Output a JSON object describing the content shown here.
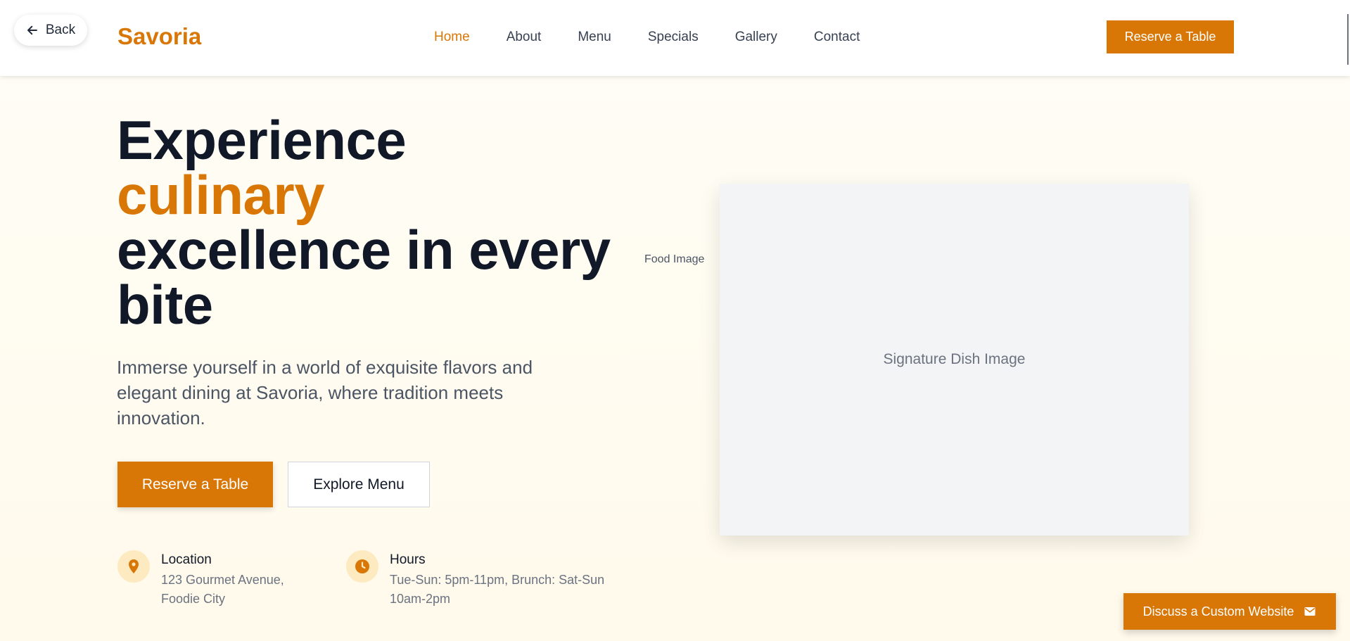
{
  "header": {
    "back_label": "Back",
    "brand": "Savoria",
    "nav": [
      "Home",
      "About",
      "Menu",
      "Specials",
      "Gallery",
      "Contact"
    ],
    "active_nav": "Home",
    "cta_label": "Reserve a Table"
  },
  "hero": {
    "title_line1": "Experience",
    "title_accent": "culinary",
    "title_line3": "excellence in every",
    "title_line4": "bite",
    "subtitle": "Immerse yourself in a world of exquisite flavors and elegant dining at Savoria, where tradition meets innovation.",
    "primary_button": "Reserve a Table",
    "secondary_button": "Explore Menu"
  },
  "info": {
    "location": {
      "label": "Location",
      "line1": "123 Gourmet Avenue,",
      "line2": "Foodie City",
      "icon": "map-pin-icon"
    },
    "hours": {
      "label": "Hours",
      "line1": "Tue-Sun: 5pm-11pm, Brunch: Sat-Sun",
      "line2": "10am-2pm",
      "icon": "clock-icon"
    }
  },
  "image": {
    "alt_label": "Food Image",
    "placeholder": "Signature Dish Image"
  },
  "floating_cta": {
    "label": "Discuss a Custom Website",
    "icon": "envelope-icon"
  },
  "colors": {
    "accent": "#d97706",
    "text_dark": "#111827",
    "text_muted": "#4b5563",
    "icon_bg": "#fdeac0"
  }
}
